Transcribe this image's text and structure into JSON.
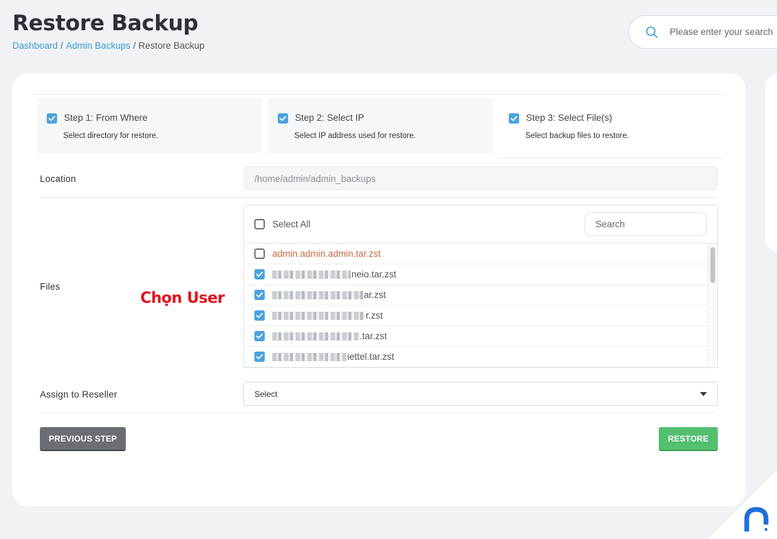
{
  "header": {
    "title": "Restore Backup",
    "breadcrumb": [
      "Dashboard",
      "Admin Backups",
      "Restore Backup"
    ],
    "search_placeholder": "Please enter your search"
  },
  "steps": [
    {
      "title": "Step 1: From Where",
      "desc": "Select directory for restore.",
      "checked": true
    },
    {
      "title": "Step 2: Select IP",
      "desc": "Select IP address used for restore.",
      "checked": true
    },
    {
      "title": "Step 3: Select File(s)",
      "desc": "Select backup files to restore.",
      "checked": true
    }
  ],
  "form": {
    "location_label": "Location",
    "location_value": "/home/admin/admin_backups",
    "files_label": "Files",
    "select_all_label": "Select All",
    "files_search_placeholder": "Search",
    "files": [
      {
        "suffix": "admin.admin.admin.tar.zst",
        "checked": false,
        "obscured": false
      },
      {
        "suffix": "neio.tar.zst",
        "checked": true,
        "obscured": true
      },
      {
        "suffix": "ar.zst",
        "checked": true,
        "obscured": true
      },
      {
        "suffix": "r.zst",
        "checked": true,
        "obscured": true
      },
      {
        "suffix": ".tar.zst",
        "checked": true,
        "obscured": true
      },
      {
        "suffix": "iettel.tar.zst",
        "checked": true,
        "obscured": true
      }
    ],
    "reseller_label": "Assign to Reseller",
    "reseller_value": "Select"
  },
  "annotation": "Chọn User",
  "buttons": {
    "previous": "PREVIOUS STEP",
    "restore": "RESTORE"
  },
  "colors": {
    "accent": "#3a9bd5",
    "checkbox": "#4aa3df",
    "restore": "#54bf6e",
    "previous": "#6b6e73",
    "annotation": "#e0141e"
  }
}
